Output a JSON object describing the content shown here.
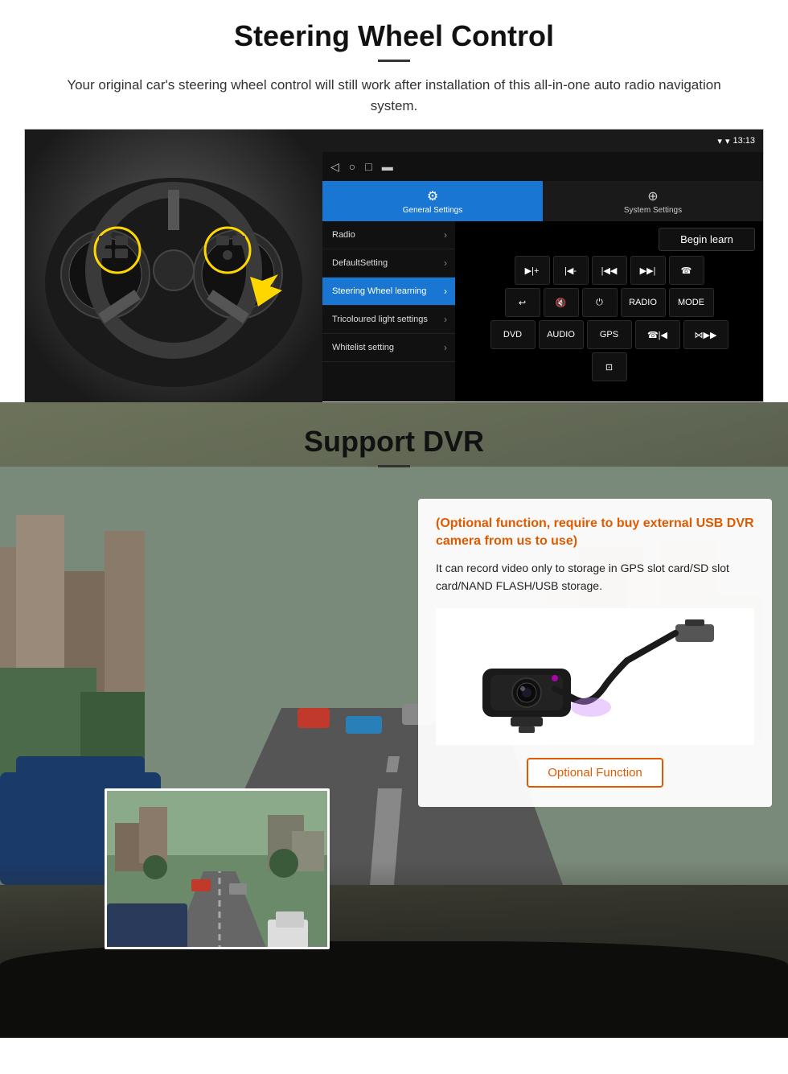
{
  "steering_wheel_section": {
    "title": "Steering Wheel Control",
    "subtitle": "Your original car's steering wheel control will still work after installation of this all-in-one auto radio navigation system.",
    "android_ui": {
      "status_bar": {
        "time": "13:13",
        "signal_icon": "▼",
        "wifi_icon": "▾"
      },
      "top_bar_icons": [
        "◁",
        "○",
        "□",
        "▬"
      ],
      "tabs": [
        {
          "label": "General Settings",
          "icon": "⚙",
          "active": true
        },
        {
          "label": "System Settings",
          "icon": "⊕",
          "active": false
        }
      ],
      "menu_items": [
        {
          "label": "Radio",
          "active": false
        },
        {
          "label": "DefaultSetting",
          "active": false
        },
        {
          "label": "Steering Wheel learning",
          "active": true
        },
        {
          "label": "Tricoloured light settings",
          "active": false
        },
        {
          "label": "Whitelist setting",
          "active": false
        }
      ],
      "begin_learn_label": "Begin learn",
      "control_buttons": [
        [
          "▶|+",
          "|◀-",
          "|◀◀",
          "▶▶|",
          "☎"
        ],
        [
          "↩",
          "🔇×",
          "⏻",
          "RADIO",
          "MODE"
        ],
        [
          "DVD",
          "AUDIO",
          "GPS",
          "☎|◀◀",
          "⋈▶▶|"
        ],
        [
          "⊡"
        ]
      ]
    }
  },
  "dvr_section": {
    "title": "Support DVR",
    "optional_text": "(Optional function, require to buy external USB DVR camera from us to use)",
    "description": "It can record video only to storage in GPS slot card/SD slot card/NAND FLASH/USB storage.",
    "optional_button_label": "Optional Function",
    "camera_alt": "USB DVR Camera"
  }
}
